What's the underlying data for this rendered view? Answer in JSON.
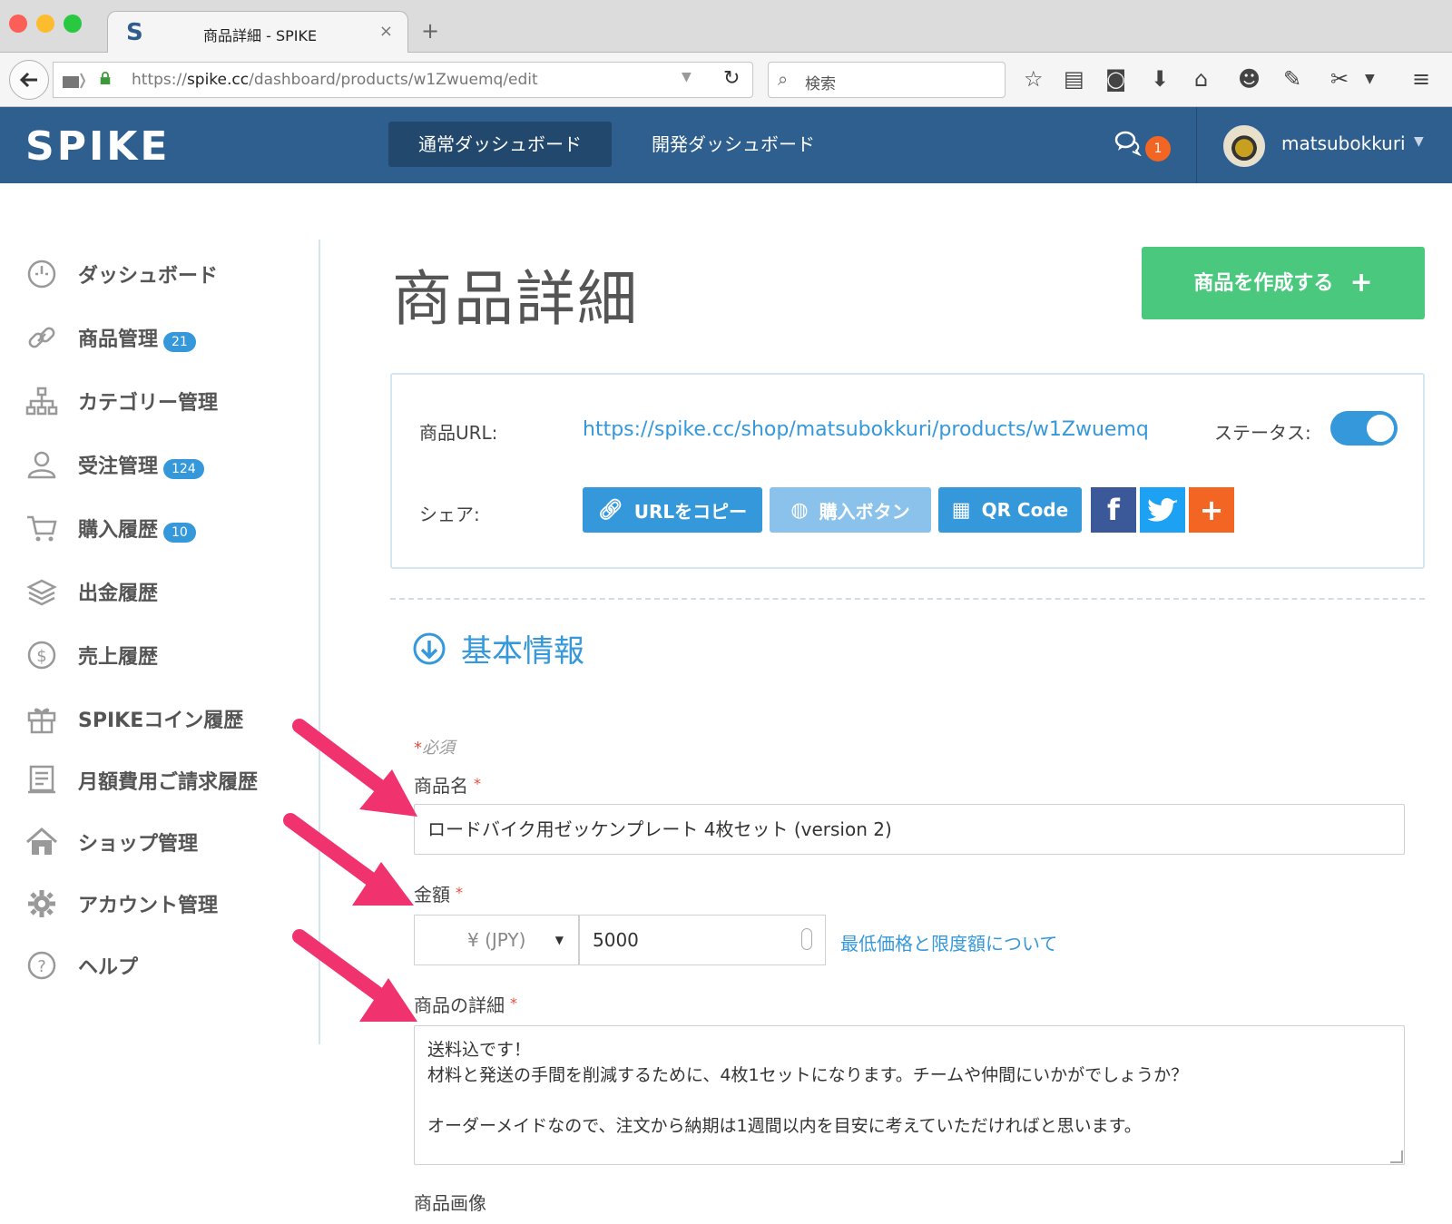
{
  "browser": {
    "tab_title": "商品詳細 - SPIKE",
    "tab_logo": "S",
    "tab_close": "×",
    "new_tab": "+",
    "url_prefix": "https://",
    "url_host": "spike.cc",
    "url_path": "/dashboard/products/w1Zwuemq/edit",
    "search_placeholder": "検索",
    "icons": [
      "star-icon",
      "reading-list-icon",
      "pocket-icon",
      "download-icon",
      "home-icon",
      "chat-bubble-icon",
      "extension-icon",
      "screenshot-icon",
      "menu-icon"
    ]
  },
  "header": {
    "logo": "SPIKE",
    "nav_normal": "通常ダッシュボード",
    "nav_dev": "開発ダッシュボード",
    "notification_count": "1",
    "username": "matsubokkuri",
    "colors": {
      "bar": "#2f5f8f",
      "active_nav": "#23486e",
      "badge": "#f26522"
    }
  },
  "sidebar": {
    "items": [
      {
        "label": "ダッシュボード",
        "icon": "dashboard-icon",
        "badge": ""
      },
      {
        "label": "商品管理",
        "icon": "link-icon",
        "badge": "21"
      },
      {
        "label": "カテゴリー管理",
        "icon": "sitemap-icon",
        "badge": ""
      },
      {
        "label": "受注管理",
        "icon": "users-icon",
        "badge": "124"
      },
      {
        "label": "購入履歴",
        "icon": "cart-icon",
        "badge": "10"
      },
      {
        "label": "出金履歴",
        "icon": "layers-icon",
        "badge": ""
      },
      {
        "label": "売上履歴",
        "icon": "dollar-icon",
        "badge": ""
      },
      {
        "label": "SPIKEコイン履歴",
        "icon": "gift-icon",
        "badge": ""
      },
      {
        "label": "月額費用ご請求履歴",
        "icon": "invoice-icon",
        "badge": ""
      },
      {
        "label": "ショップ管理",
        "icon": "home-icon",
        "badge": ""
      },
      {
        "label": "アカウント管理",
        "icon": "gear-icon",
        "badge": ""
      },
      {
        "label": "ヘルプ",
        "icon": "help-icon",
        "badge": ""
      }
    ]
  },
  "main": {
    "title": "商品詳細",
    "create_button": "商品を作成する",
    "url_label": "商品URL:",
    "product_url": "https://spike.cc/shop/matsubokkuri/products/w1Zwuemq",
    "status_label": "ステータス:",
    "status_on": true,
    "share_label": "シェア:",
    "share_buttons": {
      "copy_url": "URLをコピー",
      "buy_button": "購入ボタン",
      "qr_code": "QR Code",
      "facebook": "f",
      "twitter": "twitter",
      "plus": "+"
    },
    "section_title": "基本情報",
    "required_note": "必須",
    "required_mark": "*",
    "fields": {
      "name_label": "商品名",
      "name_value": "ロードバイク用ゼッケンプレート 4枚セット (version 2)",
      "price_label": "金額",
      "currency": "¥ (JPY)",
      "price_value": "5000",
      "price_link": "最低価格と限度額について",
      "desc_label": "商品の詳細",
      "desc_lines": [
        "送料込です！",
        "材料と発送の手間を削減するために、4枚1セットになります。チームや仲間にいかがでしょうか？",
        "",
        "オーダーメイドなので、注文から納期は1週間以内を目安に考えていただければと思います。"
      ],
      "image_label": "商品画像"
    },
    "colors": {
      "accent": "#3598db",
      "create": "#4ac97e",
      "annotation_arrow": "#f0326e"
    }
  }
}
